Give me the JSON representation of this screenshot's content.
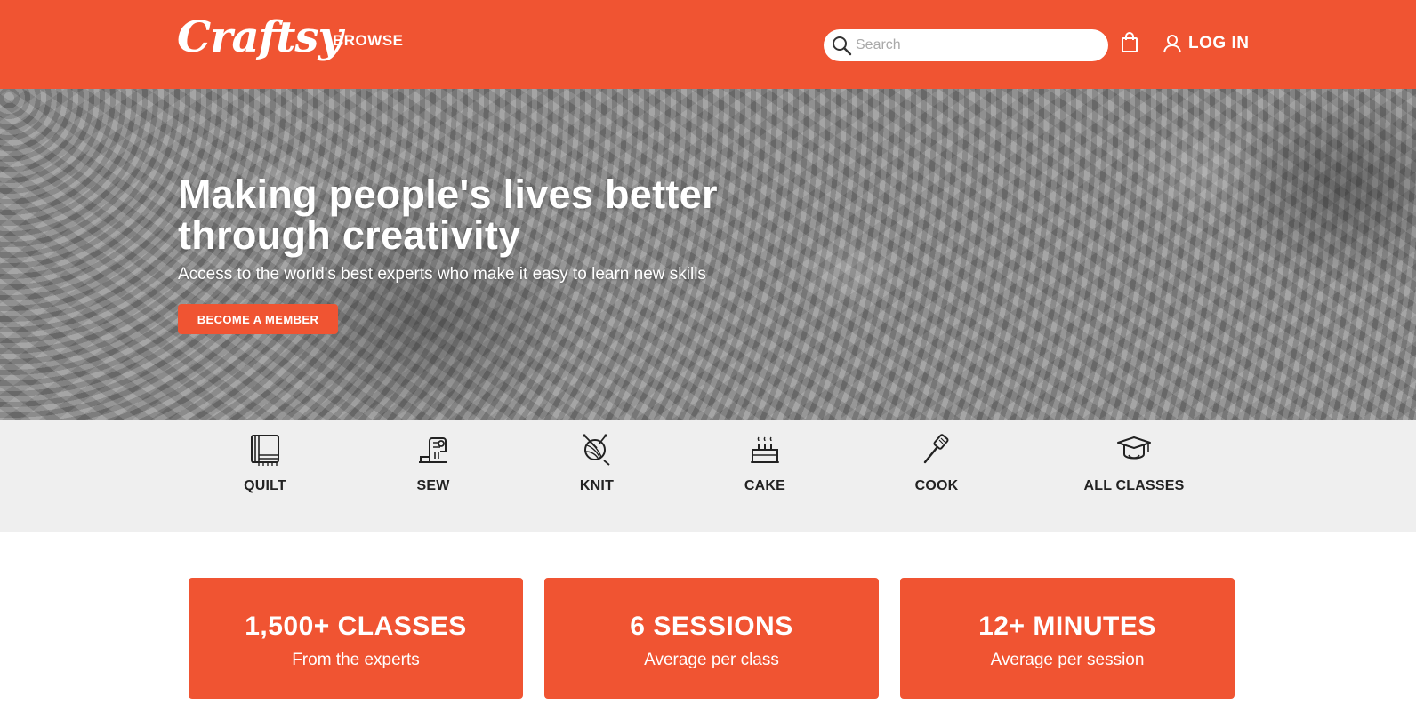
{
  "header": {
    "logo": "Craftsy",
    "browse_label": "BROWSE",
    "search_placeholder": "Search",
    "login_label": "LOG IN",
    "accent_color": "#f05432"
  },
  "hero": {
    "title": "Making people's lives better through creativity",
    "subtitle": "Access to the world's best experts who make it easy to learn new skills",
    "cta_label": "BECOME A MEMBER"
  },
  "categories": [
    {
      "label": "QUILT",
      "icon": "quilt-icon"
    },
    {
      "label": "SEW",
      "icon": "sewing-machine-icon"
    },
    {
      "label": "KNIT",
      "icon": "yarn-ball-icon"
    },
    {
      "label": "CAKE",
      "icon": "cake-icon"
    },
    {
      "label": "COOK",
      "icon": "spatula-icon"
    },
    {
      "label": "ALL CLASSES",
      "icon": "graduation-cap-icon"
    }
  ],
  "stats": [
    {
      "value": "1,500+ CLASSES",
      "caption": "From the experts"
    },
    {
      "value": "6 SESSIONS",
      "caption": "Average per class"
    },
    {
      "value": "12+ MINUTES",
      "caption": "Average per session"
    }
  ]
}
